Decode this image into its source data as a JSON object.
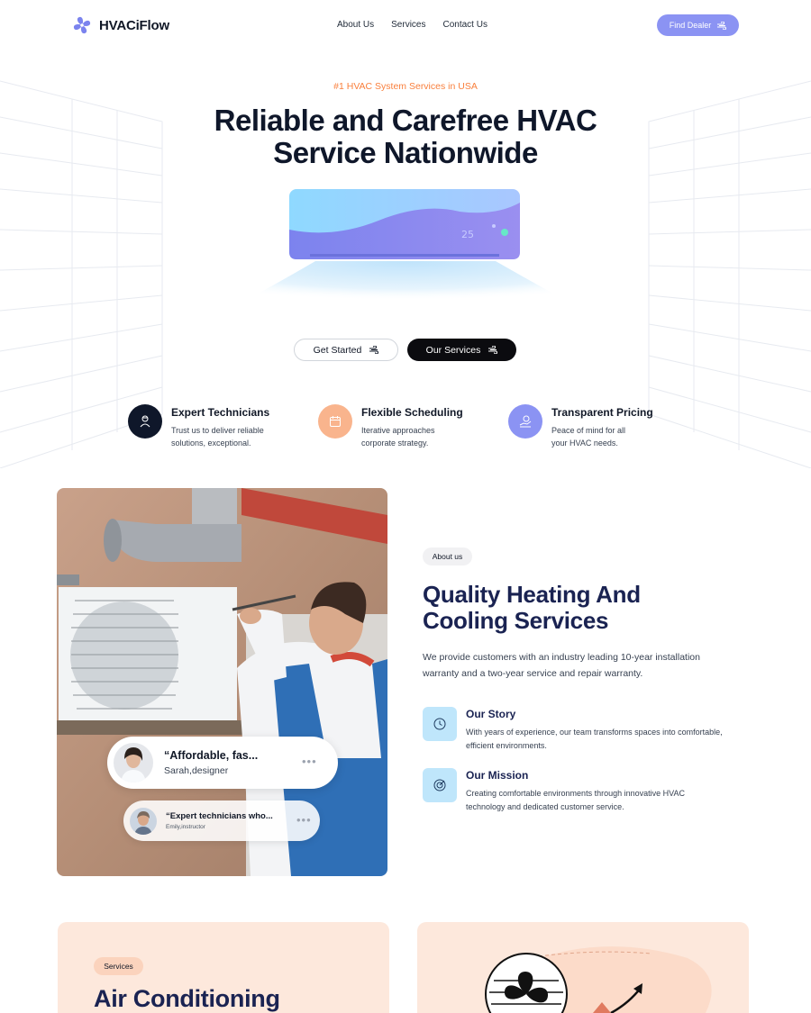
{
  "brand": {
    "name": "HVACiFlow"
  },
  "nav": {
    "items": [
      "About Us",
      "Services",
      "Contact Us"
    ]
  },
  "header": {
    "cta_label": "Find Dealer"
  },
  "hero": {
    "eyebrow": "#1 HVAC System Services in USA",
    "title_line1": "Reliable and Carefree HVAC",
    "title_line2": "Service Nationwide",
    "ac_display": "25",
    "primary_label": "Get Started",
    "secondary_label": "Our Services"
  },
  "features": [
    {
      "title": "Expert Technicians",
      "desc_line1": "Trust us to deliver reliable",
      "desc_line2": "solutions, exceptional.",
      "color": "#0f172a",
      "icon": "technician-icon"
    },
    {
      "title": "Flexible Scheduling",
      "desc_line1": "Iterative approaches",
      "desc_line2": "corporate strategy.",
      "color": "#f9b48d",
      "icon": "calendar-icon"
    },
    {
      "title": "Transparent Pricing",
      "desc_line1": "Peace of mind for all",
      "desc_line2": "your HVAC needs.",
      "color": "#8b93f3",
      "icon": "pricing-icon"
    }
  ],
  "about": {
    "tag": "About us",
    "title_line1": "Quality Heating And",
    "title_line2": "Cooling Services",
    "description": "We provide customers with an industry leading 10-year installation warranty and a two-year service and repair warranty.",
    "items": [
      {
        "title": "Our Story",
        "desc": "With years of experience, our team transforms spaces into comfortable, efficient environments.",
        "icon": "clock-icon"
      },
      {
        "title": "Our Mission",
        "desc": "Creating comfortable environments through innovative HVAC technology and dedicated customer service.",
        "icon": "target-icon"
      }
    ]
  },
  "testimonials": [
    {
      "quote": "“Affordable, fas...",
      "name": "Sarah",
      "role": ",designer"
    },
    {
      "quote": "“Expert technicians who...",
      "name": "Emily",
      "role": ",instructor"
    }
  ],
  "services": {
    "tag": "Services",
    "title": "Air Conditioning"
  },
  "colors": {
    "accent": "#8b93f3",
    "orange": "#f97f3c",
    "navy": "#1a2352",
    "peach": "#fde8dc",
    "light_blue": "#bfe6fb"
  }
}
